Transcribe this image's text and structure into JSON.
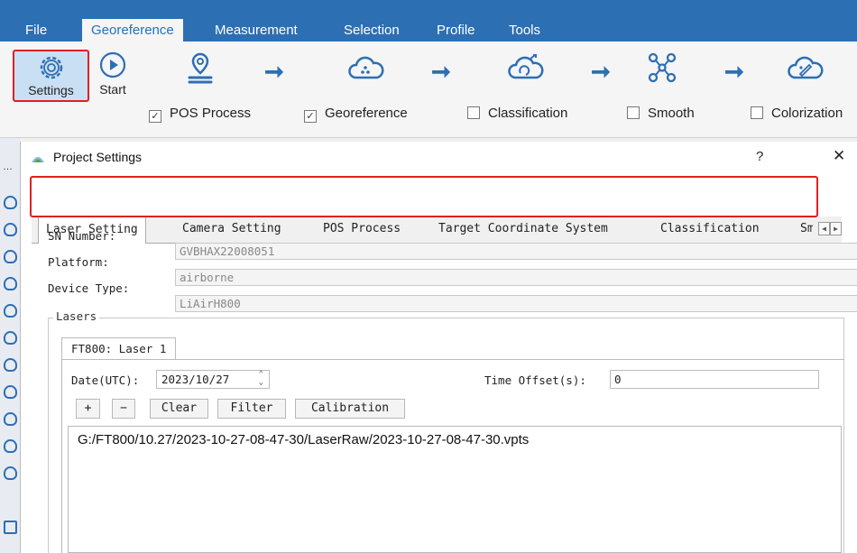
{
  "menubar": {
    "items": [
      {
        "label": "File"
      },
      {
        "label": "Georeference"
      },
      {
        "label": "Measurement"
      },
      {
        "label": "Selection"
      },
      {
        "label": "Profile"
      },
      {
        "label": "Tools"
      }
    ],
    "active": "Georeference"
  },
  "ribbon": {
    "settings_label": "Settings",
    "start_label": "Start",
    "steps": [
      {
        "label": "POS Process",
        "checked": true,
        "icon": "location-pin-icon"
      },
      {
        "label": "Georeference",
        "checked": true,
        "icon": "cloud-points-icon"
      },
      {
        "label": "Classification",
        "checked": false,
        "icon": "cloud-classify-icon"
      },
      {
        "label": "Smooth",
        "checked": false,
        "icon": "nodes-icon"
      },
      {
        "label": "Colorization",
        "checked": false,
        "icon": "cloud-color-icon"
      }
    ]
  },
  "dialog": {
    "title": "Project Settings",
    "help": "?",
    "close": "✕",
    "tabs": [
      {
        "label": "Laser Setting"
      },
      {
        "label": "Camera Setting"
      },
      {
        "label": "POS Process"
      },
      {
        "label": "Target Coordinate System"
      },
      {
        "label": "Classification"
      },
      {
        "label": "Sm"
      }
    ],
    "active_tab": "Laser Setting",
    "fields": {
      "sn_label": "SN Number:",
      "sn_value": "GVBHAX22008051",
      "platform_label": "Platform:",
      "platform_value": "airborne",
      "device_label": "Device Type:",
      "device_value": "LiAirH800"
    },
    "lasers": {
      "group_title": "Lasers",
      "tab_label": "FT800: Laser 1",
      "date_label": "Date(UTC):",
      "date_value": "2023/10/27",
      "offset_label": "Time Offset(s):",
      "offset_value": "0",
      "buttons": {
        "add": "+",
        "remove": "−",
        "clear": "Clear",
        "filter": "Filter",
        "calibration": "Calibration"
      },
      "files": [
        "G:/FT800/10.27/2023-10-27-08-47-30/LaserRaw/2023-10-27-08-47-30.vpts"
      ]
    }
  },
  "colors": {
    "accent": "#2d6fb3",
    "highlight": "#e02020"
  }
}
